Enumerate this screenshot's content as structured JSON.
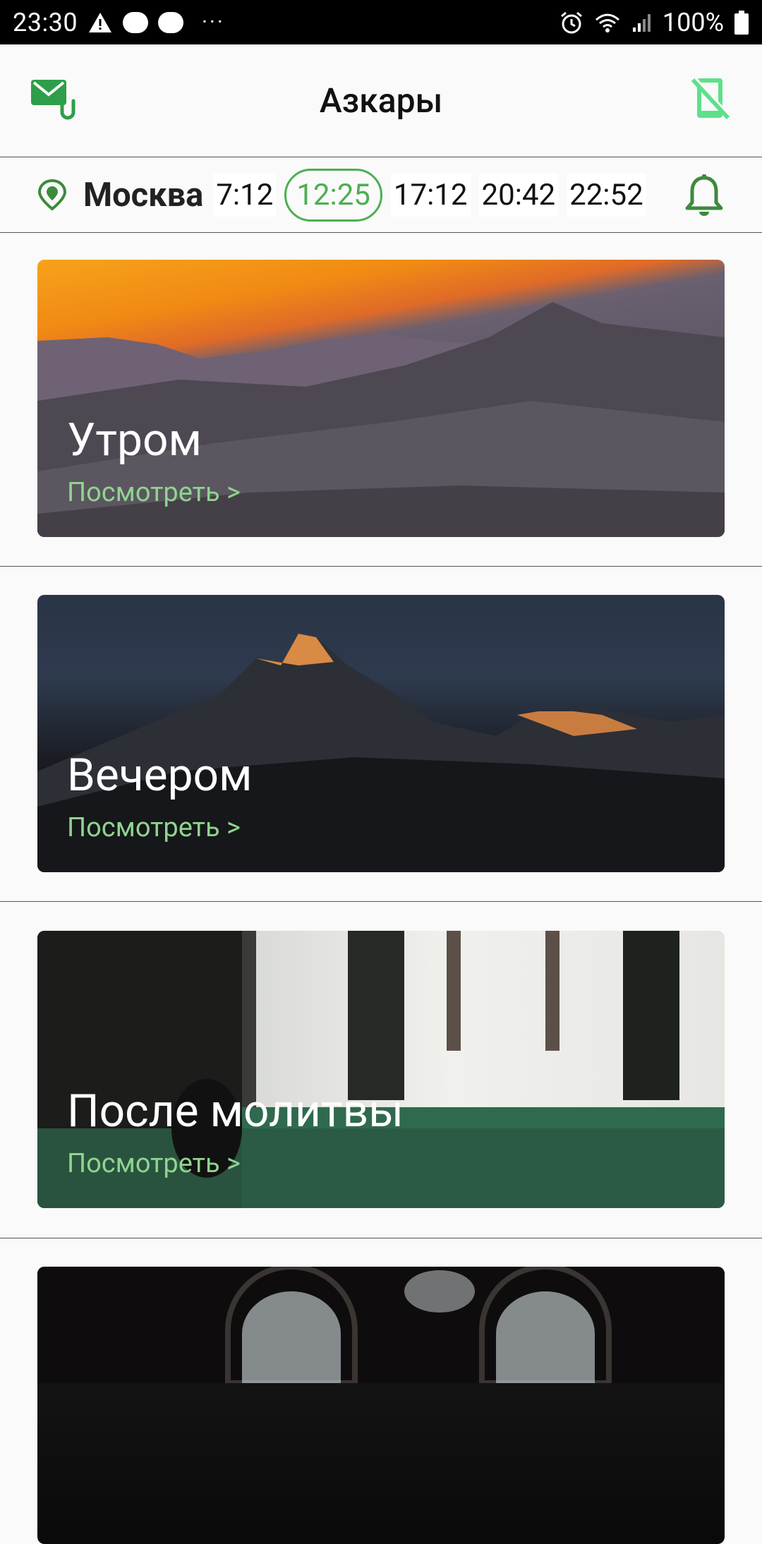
{
  "status_bar": {
    "time": "23:30",
    "battery": "100%"
  },
  "app": {
    "title": "Азкары"
  },
  "prayer": {
    "city": "Москва",
    "times": [
      "7:12",
      "12:25",
      "17:12",
      "20:42",
      "22:52"
    ],
    "active_index": 1
  },
  "cards": [
    {
      "title": "Утром",
      "link": "Посмотреть >"
    },
    {
      "title": "Вечером",
      "link": "Посмотреть >"
    },
    {
      "title": "После молитвы",
      "link": "Посмотреть >"
    },
    {
      "title": "",
      "link": ""
    }
  ],
  "colors": {
    "accent": "#4caf50",
    "link": "#8fd48f",
    "mail_icon": "#2e9e4a",
    "phone_icon": "#5ee08a"
  },
  "icons": {
    "mail": "mail-attachment-icon",
    "phone": "phone-off-icon",
    "location": "location-pin-icon",
    "bell": "bell-icon"
  }
}
